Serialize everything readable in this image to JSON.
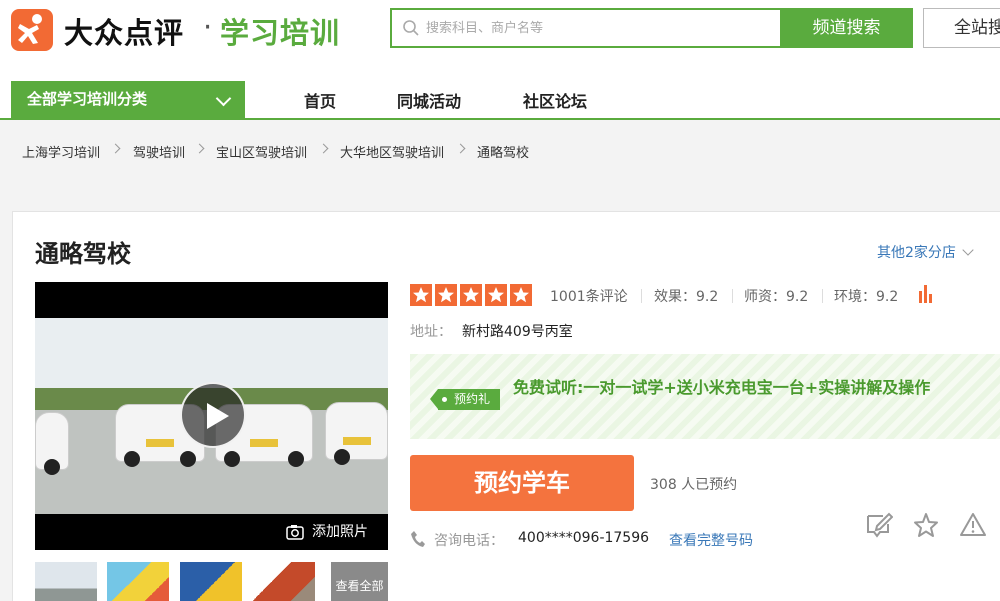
{
  "header": {
    "brand": "大众点评",
    "separator": "·",
    "channel": "学习培训",
    "search_placeholder": "搜索科目、商户名等",
    "channel_search_label": "频道搜索",
    "site_search_label": "全站搜索"
  },
  "nav": {
    "category_label": "全部学习培训分类",
    "links": [
      "首页",
      "同城活动",
      "社区论坛"
    ]
  },
  "breadcrumb": [
    "上海学习培训",
    "驾驶培训",
    "宝山区驾驶培训",
    "大华地区驾驶培训",
    "通略驾校"
  ],
  "shop": {
    "name": "通略驾校",
    "branches_label": "其他2家分店",
    "media": {
      "add_photo_label": "添加照片",
      "view_all_label": "查看全部"
    },
    "rating": {
      "stars": 5,
      "reviews": "1001条评论",
      "effect": "效果：9.2",
      "teachers": "师资：9.2",
      "environment": "环境：9.2"
    },
    "address_label": "地址：",
    "address": "新村路409号丙室",
    "promo": {
      "tag": "预约礼",
      "text": "免费试听:一对一试学+送小米充电宝一台+实操讲解及操作"
    },
    "book_label": "预约学车",
    "booked_count": "308 人已预约",
    "phone_label": "咨询电话：",
    "phone": "400****096-17596",
    "phone_full_label": "查看完整号码"
  },
  "colors": {
    "brand_orange": "#f26a34",
    "brand_green": "#5aab3e",
    "link_blue": "#3a78b8"
  }
}
